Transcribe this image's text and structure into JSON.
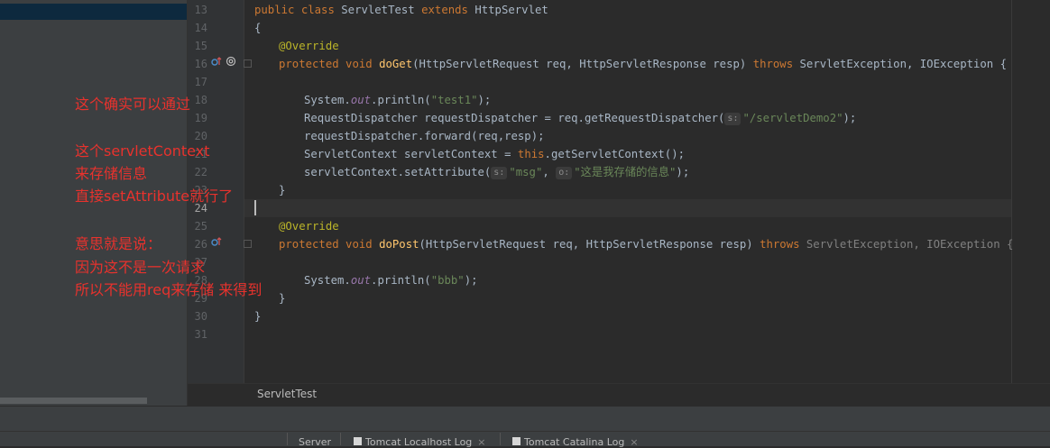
{
  "editor": {
    "file_name": "ServletTest",
    "line_numbers": [
      "13",
      "14",
      "15",
      "16",
      "17",
      "18",
      "19",
      "20",
      "21",
      "22",
      "23",
      "24",
      "25",
      "26",
      "27",
      "28",
      "29",
      "30",
      "31"
    ],
    "code": {
      "l13": {
        "a": "public",
        "b": " ",
        "c": "class",
        "d": " ServletTest ",
        "e": "extends",
        "f": " HttpServlet"
      },
      "l14": "{",
      "l15": "@Override",
      "l16": {
        "a": "protected",
        "b": " ",
        "c": "void",
        "d": " ",
        "e": "doGet",
        "f": "(HttpServletRequest req, HttpServletResponse resp) ",
        "g": "throws",
        "h": " ServletException, IOException {"
      },
      "l18": {
        "a": "System.",
        "b": "out",
        "c": ".println(",
        "d": "\"test1\"",
        "e": ");"
      },
      "l19": {
        "a": "RequestDispatcher requestDispatcher = req.getRequestDispatcher(",
        "hint": "s:",
        "b": "\"/servletDemo2\"",
        "c": ");"
      },
      "l20": "requestDispatcher.forward(req,resp);",
      "l21": {
        "a": "ServletContext servletContext = ",
        "b": "this",
        "c": ".getServletContext();"
      },
      "l22": {
        "a": "servletContext.setAttribute(",
        "hint1": "s:",
        "b": "\"msg\"",
        "c": ", ",
        "hint2": "o:",
        "d": "\"这是我存储的信息\"",
        "e": ");"
      },
      "l23": "}",
      "l25": "@Override",
      "l26": {
        "a": "protected",
        "b": " ",
        "c": "void",
        "d": " ",
        "e": "doPost",
        "f": "(HttpServletRequest req, HttpServletResponse resp) ",
        "g": "throws",
        "h": " ServletException, IOException {"
      },
      "l28": {
        "a": "System.",
        "b": "out",
        "c": ".println(",
        "d": "\"bbb\"",
        "e": ");"
      },
      "l29": "}",
      "l30": "}"
    }
  },
  "annotations": {
    "line1": "这个确实可以通过",
    "line2": "这个servletContext",
    "line3": "来存储信息",
    "line4": "直接setAttribute就行了",
    "line5": "意思就是说：",
    "line6": "因为这不是一次请求",
    "line7": "所以不能用req来存储 来得到"
  },
  "bottom_tabs": {
    "server": "Server",
    "tomcat_localhost_log": "Tomcat Localhost Log",
    "tomcat_catalina_log": "Tomcat Catalina Log",
    "close_glyph": "×"
  },
  "icons": {
    "override_gutter": "override-icon",
    "at_gutter": "annotation-icon",
    "fold_marker": "fold-icon"
  },
  "colors": {
    "annotation_red": "#e8322d",
    "keyword": "#cc7832",
    "string": "#6a8759",
    "method": "#ffc66d"
  }
}
